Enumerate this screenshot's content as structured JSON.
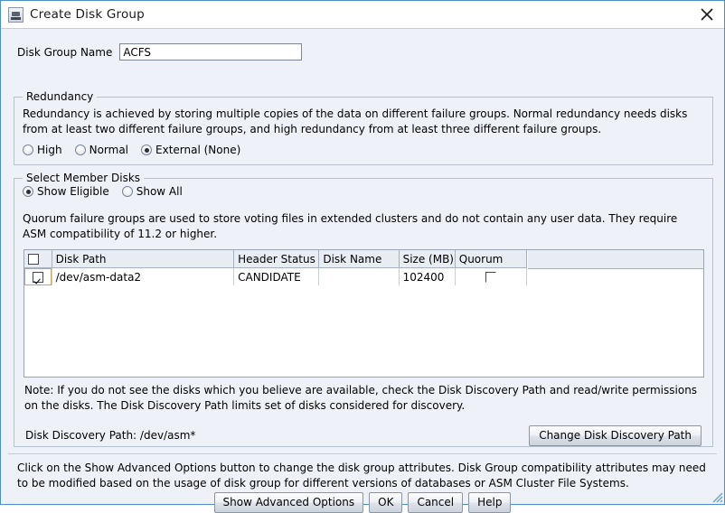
{
  "window": {
    "title": "Create Disk Group",
    "icon": "disk-group-icon",
    "close_icon": "close-icon",
    "accent_color": "#4a90c4",
    "background_color": "#eef1f8"
  },
  "disk_group_name": {
    "label": "Disk Group Name",
    "value": "ACFS",
    "placeholder": ""
  },
  "redundancy": {
    "legend": "Redundancy",
    "description": "Redundancy is achieved by storing multiple copies of the data on different failure groups. Normal redundancy needs disks from at least two different failure groups, and high redundancy from at least three different failure groups.",
    "options": [
      {
        "label": "High",
        "selected": false
      },
      {
        "label": "Normal",
        "selected": false
      },
      {
        "label": "External (None)",
        "selected": true
      }
    ]
  },
  "select_member_disks": {
    "legend": "Select Member Disks",
    "filter_options": [
      {
        "label": "Show Eligible",
        "selected": true
      },
      {
        "label": "Show All",
        "selected": false
      }
    ],
    "quorum_note": "Quorum failure groups are used to store voting files in extended clusters and do not contain any user data. They require ASM compatibility of 11.2 or higher.",
    "table": {
      "select_all_checked": false,
      "columns": [
        "",
        "Disk Path",
        "Header Status",
        "Disk Name",
        "Size (MB)",
        "Quorum"
      ],
      "rows": [
        {
          "selected": true,
          "disk_path": "/dev/asm-data2",
          "header_status": "CANDIDATE",
          "disk_name": "",
          "size_mb": "102400",
          "quorum": false
        }
      ]
    },
    "note": "Note: If you do not see the disks which you believe are available, check the Disk Discovery Path and read/write permissions on the disks. The Disk Discovery Path limits set of disks considered for discovery.",
    "discovery_path_label": "Disk Discovery Path: /dev/asm*",
    "change_path_button": "Change Disk Discovery Path"
  },
  "footer": {
    "text": "Click on the Show Advanced Options button to change the disk group attributes. Disk Group compatibility attributes may need to be modified based on the usage of disk group for different versions of databases or ASM Cluster File Systems.",
    "buttons": [
      {
        "label": "Show Advanced Options",
        "name": "show-advanced-options-button"
      },
      {
        "label": "OK",
        "name": "ok-button"
      },
      {
        "label": "Cancel",
        "name": "cancel-button"
      },
      {
        "label": "Help",
        "name": "help-button"
      }
    ]
  }
}
